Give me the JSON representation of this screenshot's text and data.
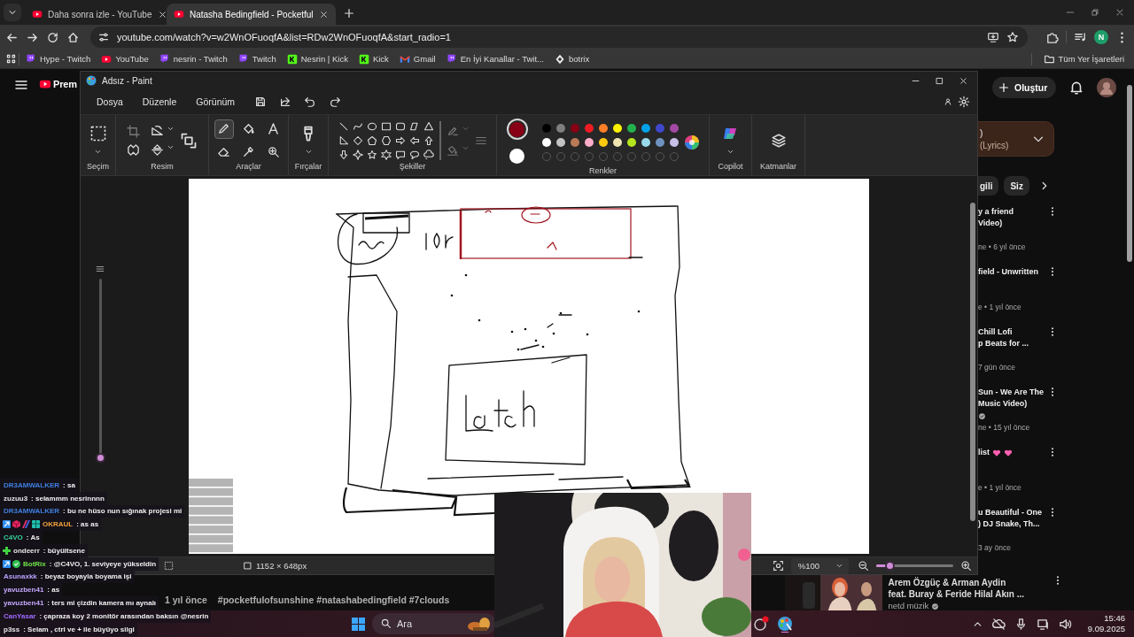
{
  "browser": {
    "tabs": [
      {
        "title": "Daha sonra izle - YouTube",
        "selected": false
      },
      {
        "title": "Natasha Bedingfield - Pocketful",
        "selected": true
      }
    ],
    "address": "youtube.com/watch?v=w2WnOFuoqfA&list=RDw2WnOFuoqfA&start_radio=1",
    "profile_initial": "N",
    "bookmarks": [
      {
        "label": "Hype - Twitch",
        "kind": "twitch"
      },
      {
        "label": "YouTube",
        "kind": "youtube"
      },
      {
        "label": "nesrin - Twitch",
        "kind": "twitch"
      },
      {
        "label": "Twitch",
        "kind": "twitch"
      },
      {
        "label": "Nesrin | Kick",
        "kind": "kick"
      },
      {
        "label": "Kick",
        "kind": "kick"
      },
      {
        "label": "Gmail",
        "kind": "gmail"
      },
      {
        "label": "En İyi Kanallar - Twit...",
        "kind": "twitch"
      },
      {
        "label": "botrix",
        "kind": "botrix"
      }
    ],
    "all_bookmarks": "Tüm Yer İşaretleri"
  },
  "youtube": {
    "logo_text": "Prem",
    "create_button": "Oluştur",
    "queue_card": {
      "title": ")",
      "subtitle": "(Lyrics)"
    },
    "chips": [
      {
        "label": "gili",
        "selected": false
      },
      {
        "label": "Siz",
        "selected": false
      }
    ],
    "related": [
      {
        "title_lines": [
          "y a friend",
          "Video)"
        ],
        "meta": "ne • 6 yıl önce",
        "verified": false,
        "hearts": false
      },
      {
        "title_lines": [
          "field - Unwritten"
        ],
        "meta": "e • 1 yıl önce",
        "verified": false,
        "hearts": false
      },
      {
        "title_lines": [
          "Chill Lofi",
          "p Beats for ..."
        ],
        "meta": "7 gün önce",
        "verified": false,
        "hearts": false
      },
      {
        "title_lines": [
          "Sun - We Are The",
          "Music Video)"
        ],
        "meta": "ne • 15 yıl önce",
        "verified": true,
        "hearts": false
      },
      {
        "title_lines": [
          "list"
        ],
        "meta": "e • 1 yıl önce",
        "verified": false,
        "hearts": true
      },
      {
        "title_lines": [
          "u Beautiful - One",
          ") DJ Snake, Th..."
        ],
        "meta": "3 ay önce",
        "verified": false,
        "hearts": false
      }
    ],
    "description_age": "1 yıl önce",
    "description_tags": "#pocketfulofsunshine #natashabedingfield #7clouds",
    "bottom_video": {
      "title_lines": [
        "Arem Özgüç & Arman Aydin",
        "feat. Buray & Feride Hilal Akın ..."
      ],
      "channel": "netd müzik",
      "verified": true
    }
  },
  "paint": {
    "title": "Adsız - Paint",
    "menu": [
      "Dosya",
      "Düzenle",
      "Görünüm"
    ],
    "ribbon_groups": [
      {
        "kind": "selection",
        "label": "Seçim"
      },
      {
        "label": "Resim"
      },
      {
        "kind": "tools",
        "label": "Araçlar"
      },
      {
        "kind": "brushes",
        "label": "Fırçalar"
      },
      {
        "kind": "shapes",
        "label": "Şekiller"
      },
      {
        "kind": "colors",
        "label": "Renkler"
      },
      {
        "kind": "copilot",
        "label": "Copilot"
      },
      {
        "kind": "layers",
        "label": "Katmanlar"
      }
    ],
    "tools": [
      {
        "kind": "pencil",
        "selected": true
      },
      {
        "kind": "fill",
        "selected": false
      },
      {
        "kind": "text",
        "selected": false
      },
      {
        "kind": "eraser",
        "selected": false
      },
      {
        "kind": "picker",
        "selected": false
      },
      {
        "kind": "magnifier",
        "selected": false
      }
    ],
    "primary_color": {
      "color": "#880015",
      "selected": true
    },
    "secondary_color": {
      "color": "#ffffff",
      "selected": false
    },
    "palette": [
      {
        "color": "#000000"
      },
      {
        "color": "#7f7f7f"
      },
      {
        "color": "#880015"
      },
      {
        "color": "#ed1c24"
      },
      {
        "color": "#ff7f27"
      },
      {
        "color": "#fff200"
      },
      {
        "color": "#22b14c"
      },
      {
        "color": "#00a2e8"
      },
      {
        "color": "#3f48cc"
      },
      {
        "color": "#a349a4"
      },
      {
        "color": "#ffffff"
      },
      {
        "color": "#c3c3c3"
      },
      {
        "color": "#b97a57"
      },
      {
        "color": "#ffaec9"
      },
      {
        "color": "#ffc90e"
      },
      {
        "color": "#efe4b0"
      },
      {
        "color": "#b5e61d"
      },
      {
        "color": "#99d9ea"
      },
      {
        "color": "#7092be"
      },
      {
        "color": "#c8bfe7"
      }
    ],
    "side_slider": {
      "level": 0
    },
    "canvas_size": "1152 × 648px",
    "zoom": "%100",
    "zoom_slider": {
      "level": 0.17
    }
  },
  "chat": [
    {
      "user": "DR3AMWALKER",
      "color": "#3f7fe0",
      "message": ": sa"
    },
    {
      "user": "zuzuu3",
      "color": "#e6e6e6",
      "message": ": selammm nesrinnnn"
    },
    {
      "user": "DR3AMWALKER",
      "color": "#3f7fe0",
      "message": ": bu ne hüso nun sığınak projesi mi"
    },
    {
      "user": "OKRAUL",
      "color": "#f2a33a",
      "message": ": as as",
      "kind": "vip"
    },
    {
      "user": "C4VO",
      "color": "#36d39b",
      "message": ": As"
    },
    {
      "user": "ondeerr",
      "color": "#e6e6e6",
      "message": ": büyültsene",
      "kind": "plus"
    },
    {
      "user": "BotRix",
      "color": "#6fe04a",
      "message": ": @C4VO, 1. seviyeye yükseldin",
      "kind": "bot"
    },
    {
      "user": "Asunaxkk",
      "color": "#b9a2ff",
      "message": ": beyaz boyayla boyama işi"
    },
    {
      "user": "yavuzben41",
      "color": "#c6a8ff",
      "message": ": as"
    },
    {
      "user": "yavuzben41",
      "color": "#c6a8ff",
      "message": ": ters mi çizdin kamera mı aynalı"
    },
    {
      "user": "CanYasar",
      "color": "#9f6bff",
      "message": ": çapraza koy 2 monitör arasından baksın @nesrin"
    },
    {
      "user": "p3ss",
      "color": "#e6e6e6",
      "message": ": Selam , ctrl ve + ile büyüyo silgi"
    }
  ],
  "taskbar": {
    "search": {
      "placeholder": "Ara"
    },
    "time": "15:46",
    "date": "9.09.2025"
  }
}
